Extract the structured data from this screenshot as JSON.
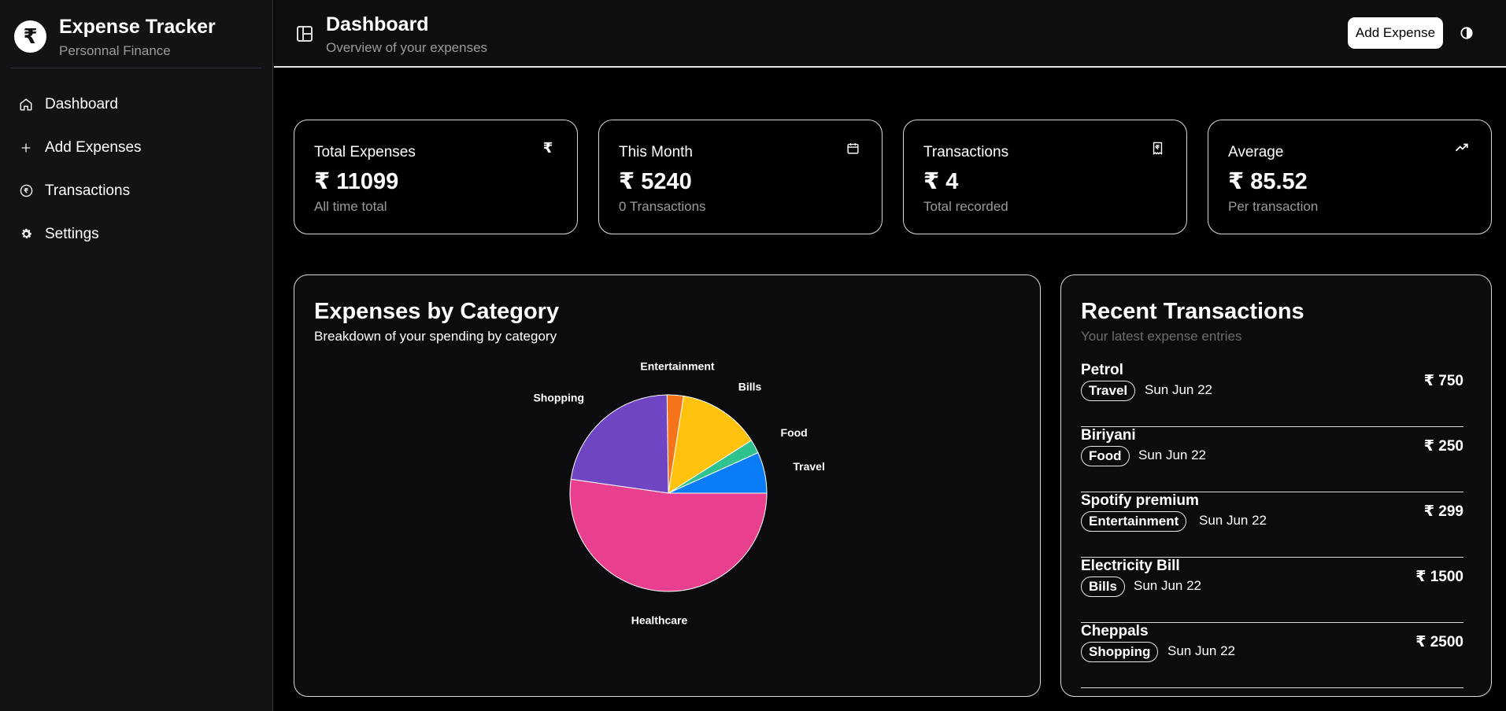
{
  "brand": {
    "title": "Expense Tracker",
    "subtitle": "Personnal Finance",
    "logo_symbol": "₹"
  },
  "sidebar": {
    "items": [
      {
        "label": "Dashboard",
        "icon": "home-icon"
      },
      {
        "label": "Add Expenses",
        "icon": "plus-icon"
      },
      {
        "label": "Transactions",
        "icon": "rupee-circle-icon"
      },
      {
        "label": "Settings",
        "icon": "gear-icon"
      }
    ]
  },
  "header": {
    "title": "Dashboard",
    "subtitle": "Overview of your expenses",
    "add_button": "Add Expense",
    "toggle_icon": "sidebar-toggle-icon",
    "theme_icon": "theme-toggle-icon"
  },
  "stats": [
    {
      "label": "Total Expenses",
      "value": "₹ 11099",
      "note": "All time total",
      "icon": "rupee-icon"
    },
    {
      "label": "This Month",
      "value": "₹ 5240",
      "note": "0 Transactions",
      "icon": "calendar-icon"
    },
    {
      "label": "Transactions",
      "value": "₹ 4",
      "note": "Total recorded",
      "icon": "receipt-icon"
    },
    {
      "label": "Average",
      "value": "₹ 85.52",
      "note": "Per transaction",
      "icon": "trending-up-icon"
    }
  ],
  "category_panel": {
    "title": "Expenses by Category",
    "subtitle": "Breakdown of your spending by category"
  },
  "chart_data": {
    "type": "pie",
    "categories": [
      "Travel",
      "Food",
      "Bills",
      "Entertainment",
      "Shopping",
      "Healthcare"
    ],
    "values": [
      750,
      250,
      1500,
      299,
      2500,
      5800
    ],
    "colors": [
      "#0a7cf5",
      "#2ec28e",
      "#ffc20e",
      "#f5731a",
      "#6f45c4",
      "#e8408e"
    ],
    "title": "",
    "legend": "none"
  },
  "recent_panel": {
    "title": "Recent Transactions",
    "subtitle": "Your latest expense entries",
    "transactions": [
      {
        "name": "Petrol",
        "category": "Travel",
        "date": "Sun Jun 22",
        "amount": "₹ 750"
      },
      {
        "name": "Biriyani",
        "category": "Food",
        "date": "Sun Jun 22",
        "amount": "₹ 250"
      },
      {
        "name": "Spotify premium",
        "category": "Entertainment",
        "date": "Sun Jun 22",
        "amount": "₹ 299"
      },
      {
        "name": "Electricity Bill",
        "category": "Bills",
        "date": "Sun Jun 22",
        "amount": "₹ 1500"
      },
      {
        "name": "Cheppals",
        "category": "Shopping",
        "date": "Sun Jun 22",
        "amount": "₹ 2500"
      }
    ]
  },
  "colors": {
    "background": "#000000",
    "sidebar": "#131316",
    "accent": "#ffffff"
  }
}
